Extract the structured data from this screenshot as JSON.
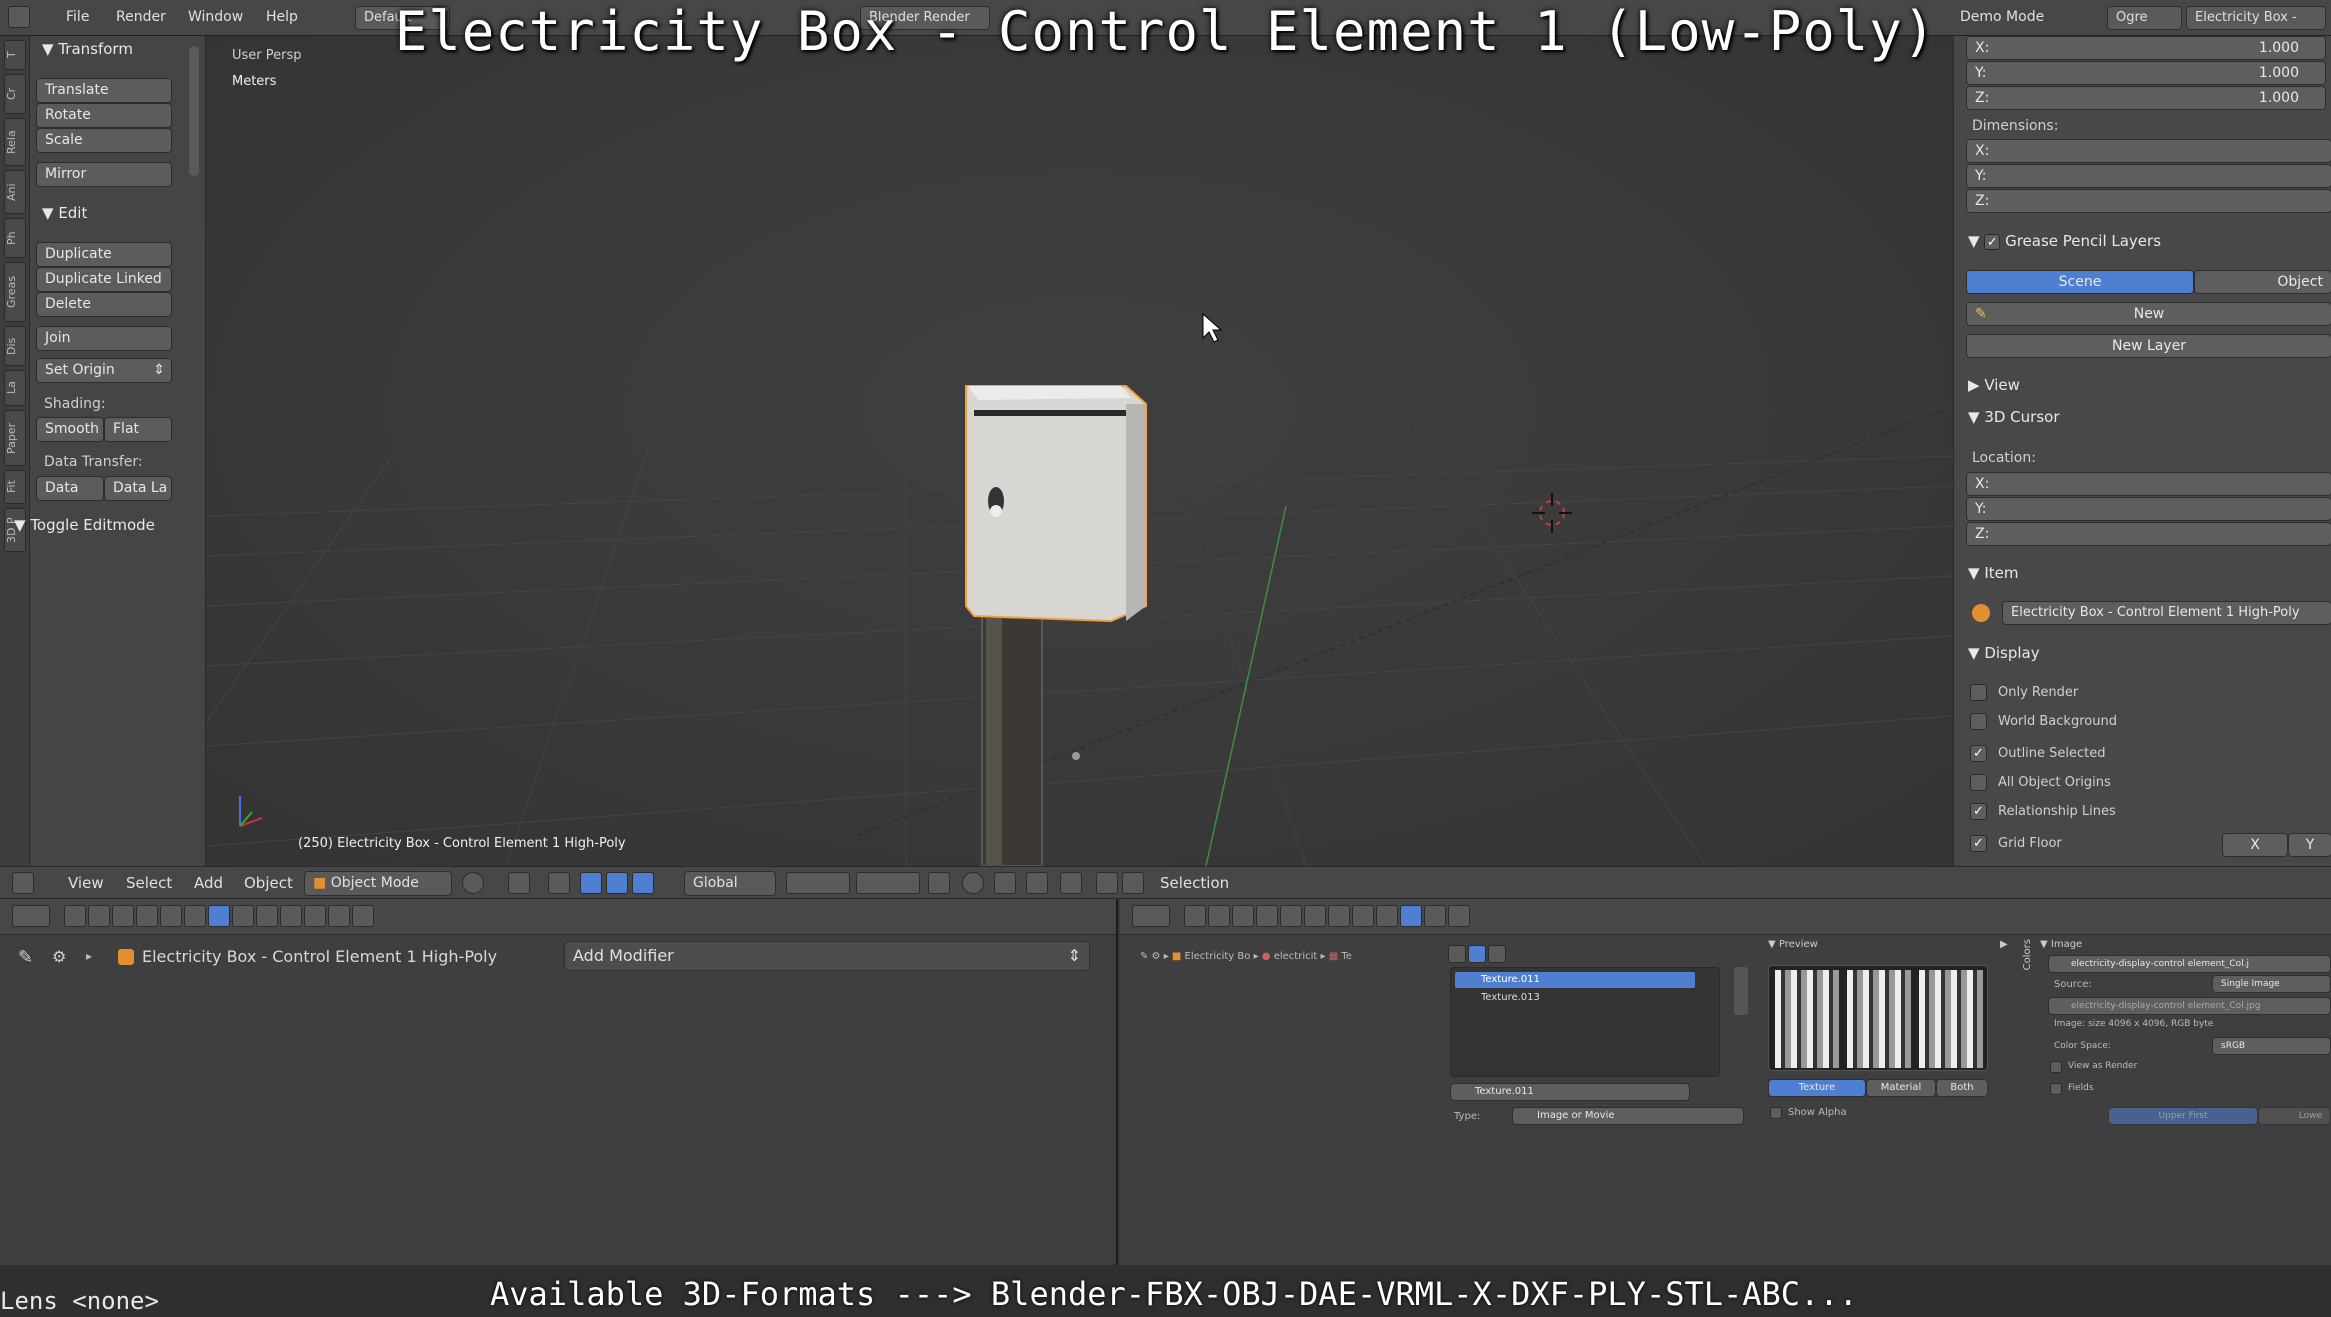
{
  "title_overlay": "Electricity Box - Control Element 1 (Low-Poly)",
  "topbar": {
    "menus": [
      "File",
      "Render",
      "Window",
      "Help"
    ],
    "layout": "Default",
    "engine": "Blender Render",
    "right_demo": "Demo Mode",
    "right_ogre": "Ogre",
    "right_scene": "Electricity Box -"
  },
  "tool_tabs": [
    "T",
    "Cr",
    "Rela",
    "Ani",
    "Ph",
    "Greas",
    "Dis",
    "La",
    "Paper",
    "Fit",
    "3D P"
  ],
  "toolshelf": {
    "transform_header": "Transform",
    "translate": "Translate",
    "rotate": "Rotate",
    "scale": "Scale",
    "mirror": "Mirror",
    "edit_header": "Edit",
    "duplicate": "Duplicate",
    "duplicate_linked": "Duplicate Linked",
    "delete": "Delete",
    "join": "Join",
    "set_origin": "Set Origin",
    "shading_label": "Shading:",
    "smooth": "Smooth",
    "flat": "Flat",
    "data_transfer_label": "Data Transfer:",
    "data": "Data",
    "data_la": "Data La",
    "toggle_editmode": "Toggle Editmode"
  },
  "viewport": {
    "view_name": "User Persp",
    "units": "Meters",
    "object_label": "(250) Electricity Box - Control Element 1 High-Poly"
  },
  "properties": {
    "scale_x_label": "X:",
    "scale_x": "1.000",
    "scale_y_label": "Y:",
    "scale_y": "1.000",
    "scale_z_label": "Z:",
    "scale_z": "1.000",
    "dimensions_label": "Dimensions:",
    "dim_x": "X:",
    "dim_y": "Y:",
    "dim_z": "Z:",
    "grease_header": "Grease Pencil Layers",
    "scene_tab": "Scene",
    "object_tab": "Object",
    "new_btn": "New",
    "new_layer_btn": "New Layer",
    "view_header": "View",
    "cursor_header": "3D Cursor",
    "location_label": "Location:",
    "loc_x": "X:",
    "loc_y": "Y:",
    "loc_z": "Z:",
    "item_header": "Item",
    "item_name": "Electricity Box - Control Element 1 High-Poly",
    "display_header": "Display",
    "only_render": "Only Render",
    "world_background": "World Background",
    "outline_selected": "Outline Selected",
    "all_object_origins": "All Object Origins",
    "relationship_lines": "Relationship Lines",
    "grid_floor": "Grid Floor",
    "grid_x": "X",
    "grid_y": "Y"
  },
  "viewport_header": {
    "view": "View",
    "select": "Select",
    "add": "Add",
    "object": "Object",
    "mode": "Object Mode",
    "orientation": "Global",
    "selection": "Selection"
  },
  "modifier_panel": {
    "object_name": "Electricity Box - Control Element 1 High-Poly",
    "add_modifier": "Add Modifier"
  },
  "texture_panel": {
    "crumb_1": "Electricity Bo",
    "crumb_2": "electricit",
    "crumb_3": "Te",
    "tex_item_1": "Texture.011",
    "tex_item_2": "Texture.013",
    "tex_name": "Texture.011",
    "type_label": "Type:",
    "type_value": "Image or Movie",
    "preview_header": "Preview",
    "tab_texture": "Texture",
    "tab_material": "Material",
    "tab_both": "Both",
    "show_alpha": "Show Alpha",
    "image_header": "Image",
    "image_name": "electricity-display-control element_Col.j",
    "source_label": "Source:",
    "source_value": "Single Image",
    "image_path": "electricity-display-control element_Col.jpg",
    "image_info": "Image: size 4096 x 4096, RGB byte",
    "colorspace_label": "Color Space:",
    "colorspace_value": "sRGB",
    "view_as_render": "View as Render",
    "fields": "Fields",
    "upper_first": "Upper First",
    "lower": "Lowe",
    "colors_tab": "Colors"
  },
  "status": {
    "lens": "Lens <none>",
    "formats": "Available 3D-Formats ---> Blender-FBX-OBJ-DAE-VRML-X-DXF-PLY-STL-ABC..."
  },
  "colors": {
    "selected_blue": "#4f7fd1",
    "object_outline": "#f0a040",
    "grid_green": "#3e8f3e"
  }
}
